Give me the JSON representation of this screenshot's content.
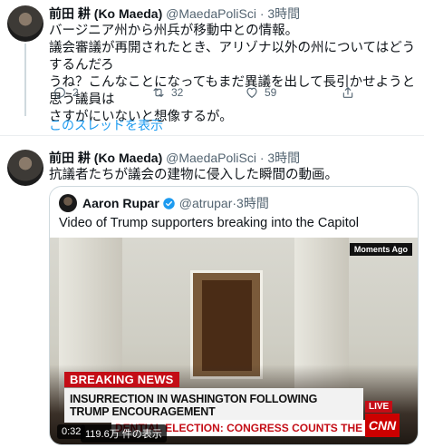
{
  "tweet1": {
    "name": "前田 耕 (Ko Maeda)",
    "handle": "@MaedaPoliSci",
    "separator": "·",
    "time": "3時間",
    "lines": [
      "バージニア州から州兵が移動中との情報。",
      "議会審議が再開されたとき、アリゾナ以外の州についてはどうするんだろ",
      "うね？こんなことになってもまだ異議を出して長引かせようと思う議員は",
      "さすがにいないと想像するが。"
    ],
    "actions": {
      "reply_count": "2",
      "retweet_count": "32",
      "like_count": "59",
      "reply_icon": "reply-icon",
      "retweet_icon": "retweet-icon",
      "like_icon": "like-icon",
      "share_icon": "share-icon"
    },
    "thread_link": "このスレッドを表示"
  },
  "tweet2": {
    "name": "前田 耕 (Ko Maeda)",
    "handle": "@MaedaPoliSci",
    "separator": "·",
    "time": "3時間",
    "text": "抗議者たちが議会の建物に侵入した瞬間の動画。",
    "quote": {
      "name": "Aaron Rupar",
      "handle": "@atrupar",
      "separator": "·",
      "time": "3時間",
      "text": "Video of Trump supporters breaking into the Capitol",
      "video": {
        "overlay_moments": "Moments Ago",
        "breaking": "BREAKING NEWS",
        "headline": "INSURRECTION IN WASHINGTON FOLLOWING TRUMP ENCOURAGEMENT",
        "ticker": "DENTIAL ELECTION: CONGRESS COUNTS THE VOTE",
        "live": "LIVE",
        "network": "CNN",
        "duration": "0:32",
        "views": "119.6万 件の表示"
      }
    }
  },
  "colors": {
    "accent": "#1d9bf0",
    "text": "#0f1419",
    "muted": "#536471",
    "news_red": "#c40d16"
  }
}
